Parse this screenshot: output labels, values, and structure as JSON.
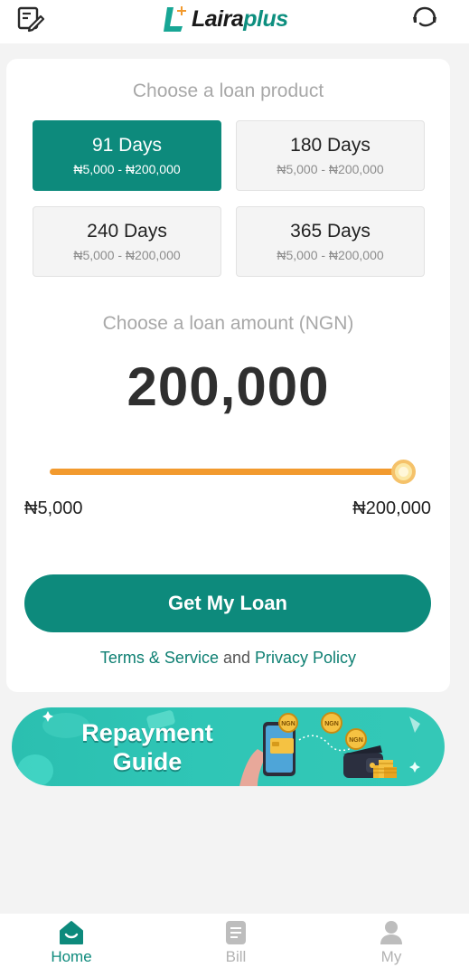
{
  "app": {
    "brand_part1": "Laira",
    "brand_part2": "plus",
    "colors": {
      "brand": "#0d8a7c",
      "accent": "#f29a2e",
      "muted": "#a8a8a8"
    }
  },
  "header": {
    "left_icon": "edit-icon",
    "right_icon": "customer-service-icon"
  },
  "loan": {
    "product_title": "Choose a loan product",
    "products": [
      {
        "days": "91 Days",
        "range": "₦5,000 - ₦200,000",
        "selected": true
      },
      {
        "days": "180 Days",
        "range": "₦5,000 - ₦200,000",
        "selected": false
      },
      {
        "days": "240 Days",
        "range": "₦5,000 - ₦200,000",
        "selected": false
      },
      {
        "days": "365 Days",
        "range": "₦5,000 - ₦200,000",
        "selected": false
      }
    ],
    "amount_title": "Choose a loan amount (NGN)",
    "amount": "200,000",
    "slider": {
      "min_label": "₦5,000",
      "max_label": "₦200,000",
      "value_fraction": 1.0
    },
    "cta_label": "Get My Loan",
    "legal": {
      "terms": "Terms & Service",
      "and": "and",
      "privacy": "Privacy Policy"
    }
  },
  "banner": {
    "line1": "Repayment",
    "line2": "Guide",
    "coin_label": "NGN"
  },
  "bottom_nav": [
    {
      "label": "Home",
      "icon": "home-icon",
      "active": true
    },
    {
      "label": "Bill",
      "icon": "bill-icon",
      "active": false
    },
    {
      "label": "My",
      "icon": "profile-icon",
      "active": false
    }
  ]
}
